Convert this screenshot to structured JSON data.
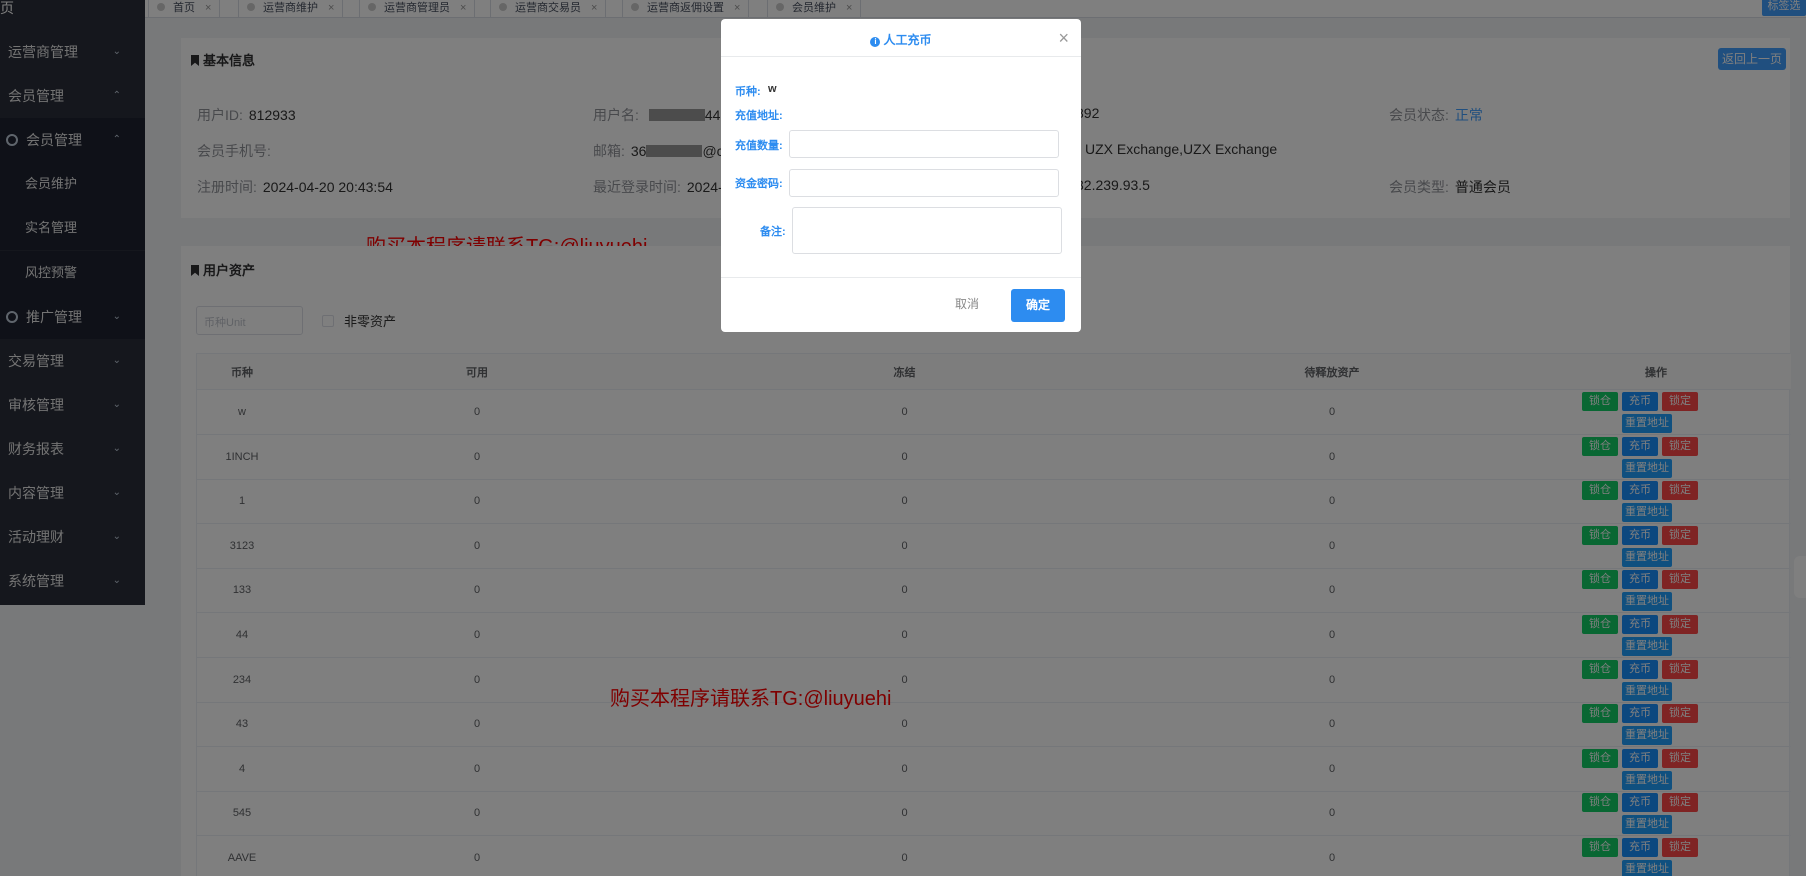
{
  "sidebar": {
    "top_title": "页",
    "items": [
      {
        "label": "运营商管理",
        "chev": "⌄"
      },
      {
        "label": "会员管理",
        "chev": "⌃"
      },
      {
        "label": "会员管理",
        "chev": "⌃"
      },
      {
        "label": "会员维护"
      },
      {
        "label": "实名管理"
      },
      {
        "label": "风控预警"
      },
      {
        "label": "推广管理",
        "chev": "⌄"
      },
      {
        "label": "交易管理",
        "chev": "⌄"
      },
      {
        "label": "审核管理",
        "chev": "⌄"
      },
      {
        "label": "财务报表",
        "chev": "⌄"
      },
      {
        "label": "内容管理",
        "chev": "⌄"
      },
      {
        "label": "活动理财",
        "chev": "⌄"
      },
      {
        "label": "系统管理",
        "chev": "⌄"
      }
    ]
  },
  "tabs": [
    {
      "label": "首页",
      "close": "×"
    },
    {
      "label": "运营商维护",
      "close": "×"
    },
    {
      "label": "运营商管理员",
      "close": "×"
    },
    {
      "label": "运营商交易员",
      "close": "×"
    },
    {
      "label": "运营商返佣设置",
      "close": "×"
    },
    {
      "label": "会员维护",
      "close": "×"
    }
  ],
  "tag_button": "标签选",
  "basic_info": {
    "title": "基本信息",
    "back_button": "返回上一页",
    "user_id_label": "用户ID:",
    "user_id": "812933",
    "username_label": "用户名:",
    "username_suffix": "44@",
    "col3_row1": "892",
    "status_label": "会员状态:",
    "status": "正常",
    "phone_label": "会员手机号:",
    "email_label": "邮箱:",
    "email_prefix": "36",
    "email_suffix": "@c",
    "col3_row2": "UZX Exchange,UZX Exchange",
    "reg_time_label": "注册时间:",
    "reg_time": "2024-04-20 20:43:54",
    "last_login_label": "最近登录时间:",
    "last_login": "2024-",
    "col3_row3": "32.239.93.5",
    "member_type_label": "会员类型:",
    "member_type": "普通会员"
  },
  "watermark_1": "购买本程序请联系TG:@liuyuehi",
  "watermark_2": "购买本程序请联系TG:@liuyuehi",
  "assets": {
    "title": "用户资产",
    "search_placeholder": "币种Unit",
    "nonzero_label": "非零资产",
    "headers": [
      "币种",
      "可用",
      "冻结",
      "待释放资产",
      "操作"
    ],
    "rows": [
      [
        "w",
        "0",
        "0",
        "0"
      ],
      [
        "1INCH",
        "0",
        "0",
        "0"
      ],
      [
        "1",
        "0",
        "0",
        "0"
      ],
      [
        "3123",
        "0",
        "0",
        "0"
      ],
      [
        "133",
        "0",
        "0",
        "0"
      ],
      [
        "44",
        "0",
        "0",
        "0"
      ],
      [
        "234",
        "0",
        "0",
        "0"
      ],
      [
        "43",
        "0",
        "0",
        "0"
      ],
      [
        "4",
        "0",
        "0",
        "0"
      ],
      [
        "545",
        "0",
        "0",
        "0"
      ],
      [
        "AAVE",
        "0",
        "0",
        "0"
      ]
    ],
    "op_labels": {
      "lock": "锁仓",
      "charge": "充币",
      "freeze": "锁定",
      "reset": "重置地址"
    }
  },
  "dialog": {
    "title": "人工充币",
    "info_icon": "i",
    "close_icon": "×",
    "coin_label": "币种:",
    "coin_value": "w",
    "address_label": "充值地址:",
    "amount_label": "充值数量:",
    "password_label": "资金密码:",
    "remark_label": "备注:",
    "cancel": "取消",
    "confirm": "确定"
  },
  "colors": {
    "sidebar_bg": "#2b2f3a",
    "primary": "#2d8cf0",
    "success": "#13ce66",
    "danger": "#ff4949",
    "watermark": "#ff0000"
  }
}
